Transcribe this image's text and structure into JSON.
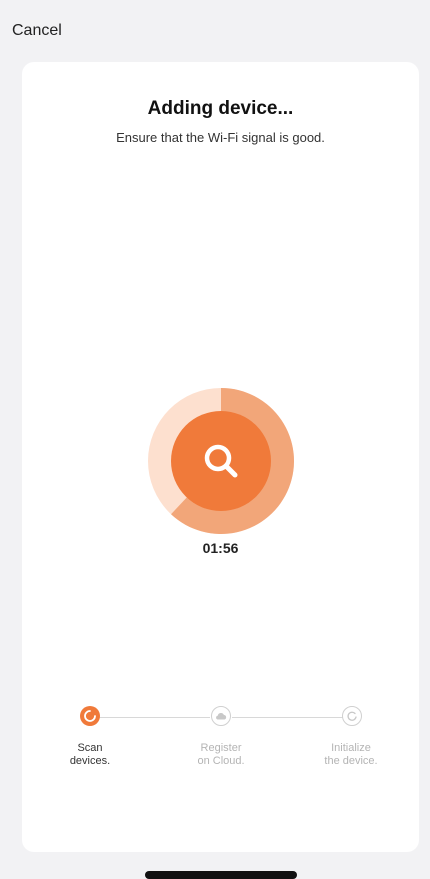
{
  "header": {
    "cancel_label": "Cancel"
  },
  "main": {
    "title": "Adding device...",
    "subtitle": "Ensure that the Wi-Fi signal is good.",
    "timer": "01:56",
    "progress_fraction": 0.62
  },
  "steps": [
    {
      "label_line1": "Scan",
      "label_line2": "devices.",
      "state": "active",
      "icon": "spinner-icon"
    },
    {
      "label_line1": "Register",
      "label_line2": "on Cloud.",
      "state": "pending",
      "icon": "cloud-icon"
    },
    {
      "label_line1": "Initialize",
      "label_line2": "the device.",
      "state": "pending",
      "icon": "refresh-icon"
    }
  ],
  "colors": {
    "accent": "#f07a3a",
    "accent_light": "#f4b896",
    "ring_track": "#fde2d2",
    "pending": "#c8c8c8",
    "background": "#f2f2f4"
  }
}
